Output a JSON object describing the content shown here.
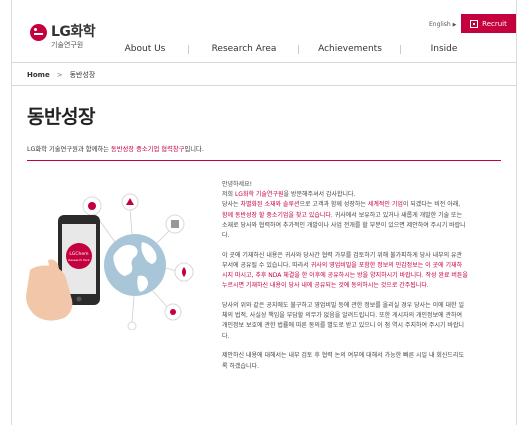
{
  "header": {
    "logo_name": "LG화학",
    "logo_sub": "기술연구원",
    "nav": [
      "About Us",
      "Research Area",
      "Achievements",
      "Inside"
    ],
    "lang_label": "English",
    "recruit_label": "Recruit"
  },
  "breadcrumb": {
    "home": "Home",
    "current": "동반성장"
  },
  "page_title": "동반성장",
  "intro": {
    "pre": "LG화학 기술연구원과 함께하는 ",
    "highlight": "동반성장 중소기업 협력창구",
    "post": "입니다."
  },
  "illustration": {
    "phone_label": "LGChem Research Park"
  },
  "body": {
    "p1": {
      "l1": "안녕하세요!",
      "l2_pre": "저희 ",
      "l2_hl": "LG화학 기술연구원",
      "l2_post": "을 방문해주셔서 감사합니다.",
      "l3_pre": "당사는 ",
      "l3_hl1": "차별화된 소재와 솔루션",
      "l3_mid": "으로 고객과 함께 성장하는 ",
      "l3_hl2": "세계적인 기업",
      "l3_post": "이 되겠다는 비전 아래,",
      "l4_hl": "함께 동반성장 할 중소기업을 찾고 있습니다.",
      "l4_post": " 귀사에서 보유하고 있거나 새롭게 개발한 기술 또는",
      "l5": "소재로 당사와 협력하여 추가적인 개발이나 사업 전개를 할 부분이 있으면 제안하여 주시기 바랍니",
      "l6": "다."
    },
    "p2": {
      "l1": "이 곳에 기재하신 내용은 귀사와 당사간 협력 가부를 검토하기 위해 불가피하게 당사 내부의 유관",
      "l2_pre": "부서에 공유될 수 있습니다. 따라서 ",
      "l2_hl": "귀사의 영업비밀을 포함한 정보의 민감정보는 이 곳에 기재하",
      "l3_hl": "시지 마시고, 추후 NDA 체결을 한 이후에 공유하시는 방을 양지하시기 바랍니다. 작성 완료 버튼을",
      "l4_hl": "누르시면 기재하신 내용이 당사 내에 공유되는 것에 동의하시는 것으로 간주됩니다."
    },
    "p3": {
      "l1": "당사의 위와 같은 공지에도 불구하고 영업비밀 등에 관한 정보를 올리실 경우 당사는 이에 대한 일",
      "l2": "체의 법적, 사실상 책임을 부담할 의무가 없음을 알려드립니다. 또한 게시자의 개인정보에 관하여",
      "l3": "개인정보 보호에 관한 법률에 따른 동의를 별도로 받고 있으니 이 점 역시 주지하여 주시기 바랍니",
      "l4": "다."
    },
    "p4": {
      "l1": "제안하신 내용에 대해서는 내부 검토 후 협력 논의 여부에 대해서 가능한 빠른 시일 내 회신드리도",
      "l2": "록 하겠습니다."
    }
  },
  "colors": {
    "brand": "#c5003e",
    "text": "#333333",
    "muted": "#777777",
    "globe": "#a9c6d9"
  },
  "icons": [
    "lg-logo-icon",
    "recruit-icon",
    "chevron-right-icon",
    "phone-icon",
    "globe-icon",
    "lab-flask-icon"
  ]
}
